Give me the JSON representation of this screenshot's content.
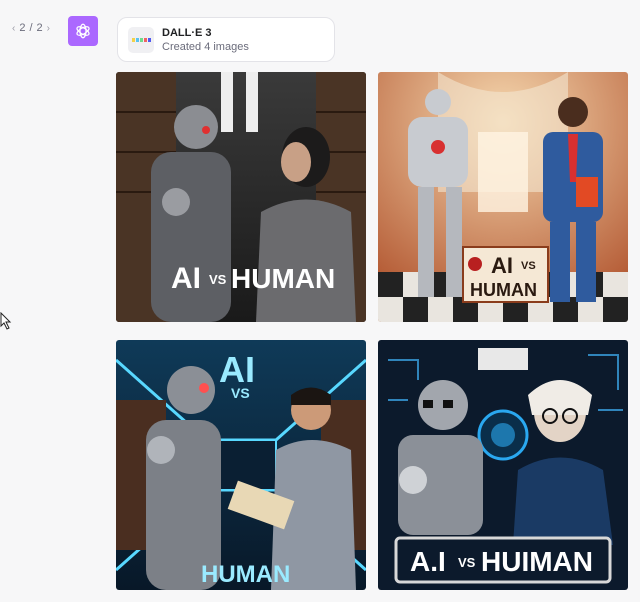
{
  "pager": {
    "prev_icon": "chevron-left-icon",
    "current": "2",
    "separator": "/",
    "total": "2",
    "next_icon": "chevron-right-icon"
  },
  "assistant": {
    "avatar_icon": "openai-logo-icon",
    "avatar_color": "#ab68ff"
  },
  "tool_card": {
    "title_prefix": "DALL·E",
    "title_version": "3",
    "subtitle": "Created 4 images"
  },
  "images": [
    {
      "overlay_text": "AI VS HUMAN",
      "main_color": "#2a2a2a"
    },
    {
      "overlay_text": "AI VS HUMAN",
      "main_color": "#c0673a"
    },
    {
      "overlay_text_top": "AI",
      "overlay_text_mid": "VS",
      "overlay_text_bottom": "HUMAN",
      "main_color": "#0e2c44"
    },
    {
      "overlay_text": "A.I VS HUIMAN",
      "main_color": "#0a1a2c"
    }
  ]
}
